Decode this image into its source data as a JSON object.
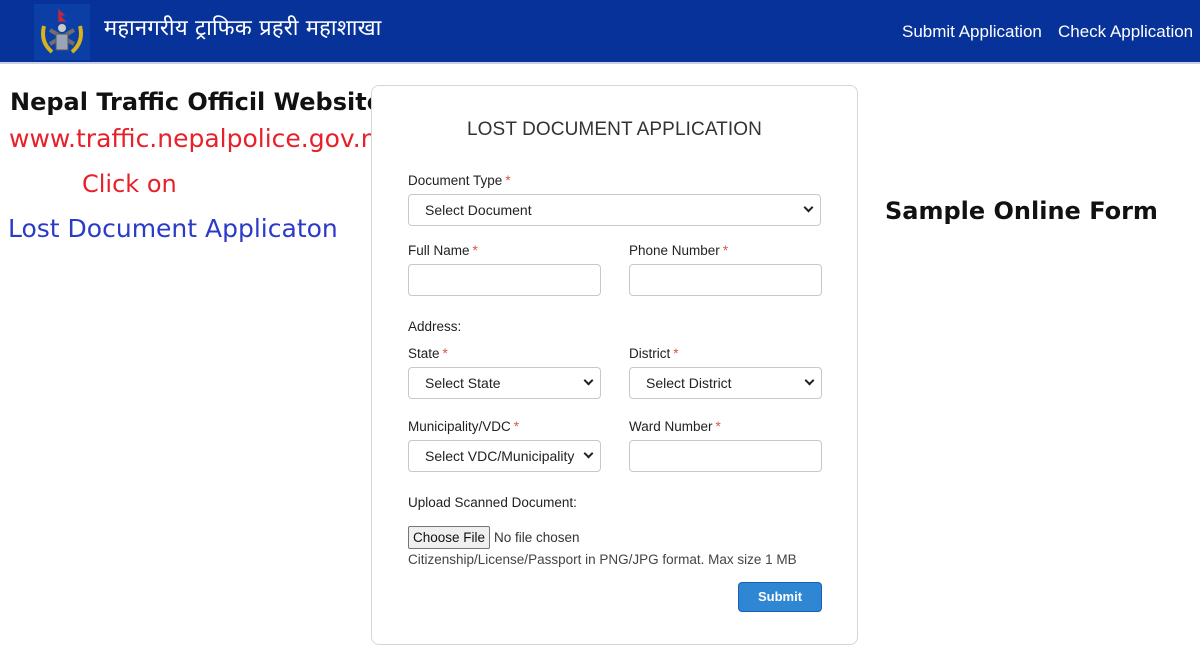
{
  "header": {
    "brand": "महानगरीय ट्राफिक प्रहरी महाशाखा",
    "logo_icon": "nepal-police-emblem-icon",
    "nav": {
      "submit_application": "Submit Application",
      "check_application": "Check Application"
    }
  },
  "promo": {
    "title": "Nepal Traffic Officil Website:",
    "url": "www.traffic.nepalpolice.gov.np",
    "click_on": "Click on",
    "link_text": "Lost Document Applicaton",
    "sample_label": "Sample Online Form",
    "colors": {
      "url": "#e8202a",
      "click": "#e8202a",
      "link": "#2b3bc6"
    }
  },
  "form": {
    "title": "LOST DOCUMENT APPLICATION",
    "required_mark": "*",
    "document_type": {
      "label": "Document Type",
      "selected": "Select Document"
    },
    "full_name": {
      "label": "Full Name",
      "value": ""
    },
    "phone_number": {
      "label": "Phone Number",
      "value": ""
    },
    "address_label": "Address:",
    "state": {
      "label": "State",
      "selected": "Select State"
    },
    "district": {
      "label": "District",
      "selected": "Select District"
    },
    "municipality": {
      "label": "Municipality/VDC",
      "selected": "Select VDC/Municipality"
    },
    "ward_number": {
      "label": "Ward Number",
      "value": ""
    },
    "upload": {
      "label": "Upload Scanned Document:",
      "button": "Choose File",
      "status": "No file chosen",
      "hint": "Citizenship/License/Passport in PNG/JPG format. Max size 1 MB"
    },
    "submit_label": "Submit"
  }
}
